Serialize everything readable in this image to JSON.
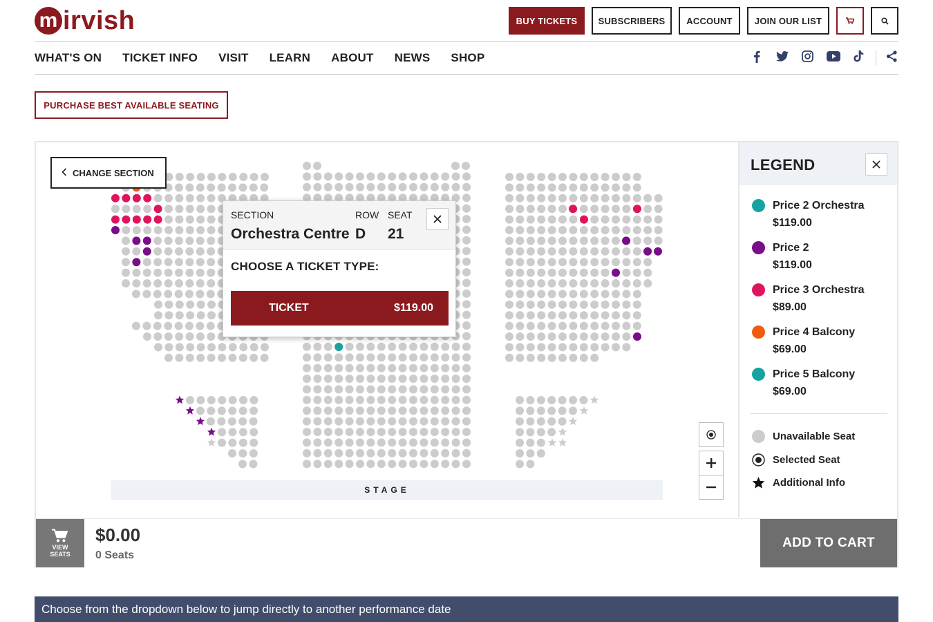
{
  "header": {
    "logo_text": "irvish",
    "logo_letter": "m",
    "buttons": {
      "buy_tickets": "BUY TICKETS",
      "subscribers": "SUBSCRIBERS",
      "account": "ACCOUNT",
      "join": "JOIN OUR LIST"
    }
  },
  "nav": {
    "items": [
      "WHAT'S ON",
      "TICKET INFO",
      "VISIT",
      "LEARN",
      "ABOUT",
      "NEWS",
      "SHOP"
    ]
  },
  "social": [
    "facebook-icon",
    "twitter-icon",
    "instagram-icon",
    "youtube-icon",
    "tiktok-icon",
    "share-icon"
  ],
  "best_seating_label": "PURCHASE BEST AVAILABLE SEATING",
  "map": {
    "change_section_label": "CHANGE SECTION",
    "stage_label": "STAGE",
    "popup": {
      "section_label": "SECTION",
      "section_value": "Orchestra Centre",
      "row_label": "ROW",
      "row_value": "D",
      "seat_label": "SEAT",
      "seat_value": "21",
      "choose_label": "CHOOSE A TICKET TYPE:",
      "ticket_label": "TICKET",
      "ticket_price": "$119.00"
    }
  },
  "legend": {
    "title": "LEGEND",
    "prices": [
      {
        "name": "Price 2 Orchestra",
        "price": "$119.00",
        "color": "#17a2a2"
      },
      {
        "name": "Price 2",
        "price": "$119.00",
        "color": "#7a0d8a"
      },
      {
        "name": "Price 3 Orchestra",
        "price": "$89.00",
        "color": "#e0145e"
      },
      {
        "name": "Price 4 Balcony",
        "price": "$69.00",
        "color": "#f25a0f"
      },
      {
        "name": "Price 5 Balcony",
        "price": "$69.00",
        "color": "#17a2a2"
      }
    ],
    "unavailable": "Unavailable Seat",
    "selected": "Selected Seat",
    "additional": "Additional Info"
  },
  "cart": {
    "view_seats_line1": "VIEW",
    "view_seats_line2": "SEATS",
    "total": "$0.00",
    "seats": "0 Seats",
    "add_to_cart": "ADD TO CART"
  },
  "banner": "Choose from the dropdown below to jump directly to another performance date",
  "colors": {
    "brand": "#8b1a1f",
    "unavailable": "#cccccc",
    "teal": "#17a2a2",
    "purple": "#7a0d8a",
    "pink": "#e0145e",
    "orange": "#f25a0f",
    "banner": "#414d6b"
  }
}
